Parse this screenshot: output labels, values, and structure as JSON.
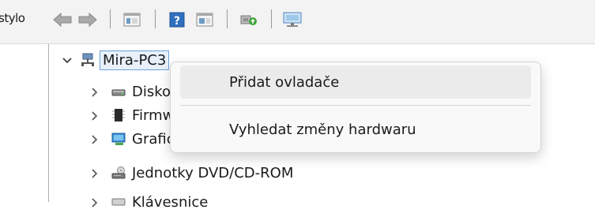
{
  "toolbar": {
    "menu_stub": "stylo",
    "buttons": [
      "back-arrow-icon",
      "forward-arrow-icon",
      "properties-icon",
      "help-icon",
      "view-icon",
      "scan-hardware-icon",
      "monitor-icon"
    ]
  },
  "tree": {
    "root_label": "Mira-PC3",
    "items": [
      {
        "label": "Diskové jednotky",
        "icon": "disk-drive-icon"
      },
      {
        "label": "Firmware",
        "icon": "firmware-icon"
      },
      {
        "label": "Grafické adaptéry",
        "icon": "display-adapter-icon"
      },
      {
        "label": "Jednotky DVD/CD-ROM",
        "icon": "dvd-drive-icon"
      },
      {
        "label": "Klávesnice",
        "icon": "keyboard-icon"
      }
    ]
  },
  "context_menu": {
    "items": [
      {
        "label": "Přidat ovladače",
        "state": "hover"
      },
      {
        "label": "Vyhledat změny hardwaru",
        "state": "normal"
      }
    ]
  },
  "colors": {
    "menu_bg": "#f9f9f9",
    "menu_hover": "#ebebeb",
    "selection_border": "#6f9fd8",
    "toolbar_bg": "#f3f3f3"
  }
}
